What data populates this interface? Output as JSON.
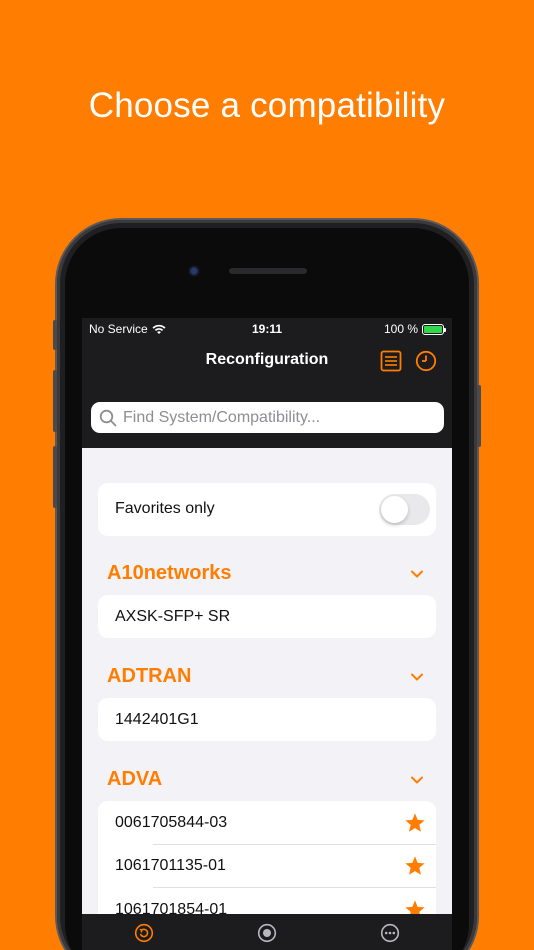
{
  "headline": "Choose a compatibility",
  "status": {
    "carrier": "No Service",
    "time": "19:11",
    "battery": "100 %"
  },
  "nav": {
    "title": "Reconfiguration",
    "left_icon": "list-icon",
    "right_icon": "clock-icon"
  },
  "search": {
    "placeholder": "Find System/Compatibility..."
  },
  "favorites": {
    "label": "Favorites only",
    "enabled": false
  },
  "sections": [
    {
      "title": "A10networks",
      "items": [
        {
          "label": "AXSK-SFP+ SR",
          "favorite": false
        }
      ]
    },
    {
      "title": "ADTRAN",
      "items": [
        {
          "label": "1442401G1",
          "favorite": false
        }
      ]
    },
    {
      "title": "ADVA",
      "items": [
        {
          "label": "0061705844-03",
          "favorite": true
        },
        {
          "label": "1061701135-01",
          "favorite": true
        },
        {
          "label": "1061701854-01",
          "favorite": true
        }
      ]
    }
  ],
  "tabbar": {
    "tabs": [
      {
        "icon": "reconfigure-icon",
        "active": true
      },
      {
        "icon": "record-icon",
        "active": false
      },
      {
        "icon": "more-icon",
        "active": false
      }
    ]
  },
  "colors": {
    "accent": "#FF7D00",
    "background": "#FF7D00",
    "dark_bar": "#1C1C1E",
    "battery": "#32D74B"
  }
}
